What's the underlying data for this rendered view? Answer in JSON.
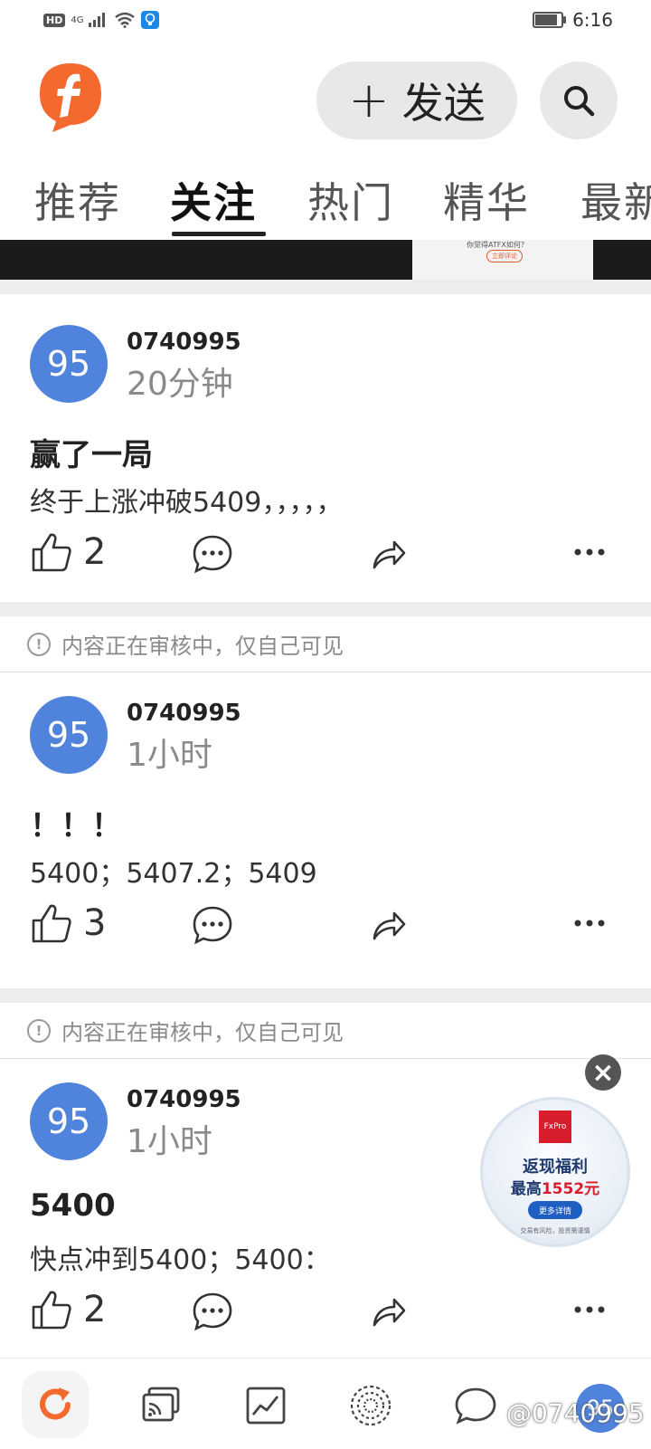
{
  "status_bar": {
    "hd": "HD",
    "network": "4G",
    "time": "6:16",
    "battery_level": 0.8
  },
  "header": {
    "logo_icon": "feed-f-logo",
    "send_label": "发送",
    "send_icon": "plus-icon",
    "search_icon": "search-icon",
    "accent_color": "#f46a2e"
  },
  "tabs": [
    {
      "label": "推荐",
      "active": false
    },
    {
      "label": "关注",
      "active": true
    },
    {
      "label": "热门",
      "active": false
    },
    {
      "label": "精华",
      "active": false
    },
    {
      "label": "最新",
      "active": false
    }
  ],
  "banner_text": "你觉得ATFX如何?",
  "banner_button": "立即评论",
  "posts": [
    {
      "avatar_text": "95",
      "username": "0740995",
      "time": "20分钟",
      "title": "赢了一局",
      "body": "终于上涨冲破5409，，，，，",
      "likes": "2",
      "notice": "内容正在审核中，仅自己可见"
    },
    {
      "avatar_text": "95",
      "username": "0740995",
      "time": "1小时",
      "title": "！！！",
      "body": "5400；5407.2；5409",
      "likes": "3",
      "notice": "内容正在审核中，仅自己可见"
    },
    {
      "avatar_text": "95",
      "username": "0740995",
      "time": "1小时",
      "title": "5400",
      "body": "快点冲到5400；5400：",
      "likes": "2"
    }
  ],
  "ad": {
    "brand": "FxPro",
    "line1": "返现福利",
    "line2_prefix": "最高",
    "line2_amount": "1552元",
    "button": "更多详情",
    "footer": "交易有风险，投资需谨慎",
    "close_icon": "close-icon"
  },
  "bottom_nav": {
    "items": [
      "refresh-icon",
      "cast-icon",
      "chart-icon",
      "globe-icon",
      "message-icon"
    ],
    "avatar_text": "95"
  },
  "watermark": "@0740995"
}
